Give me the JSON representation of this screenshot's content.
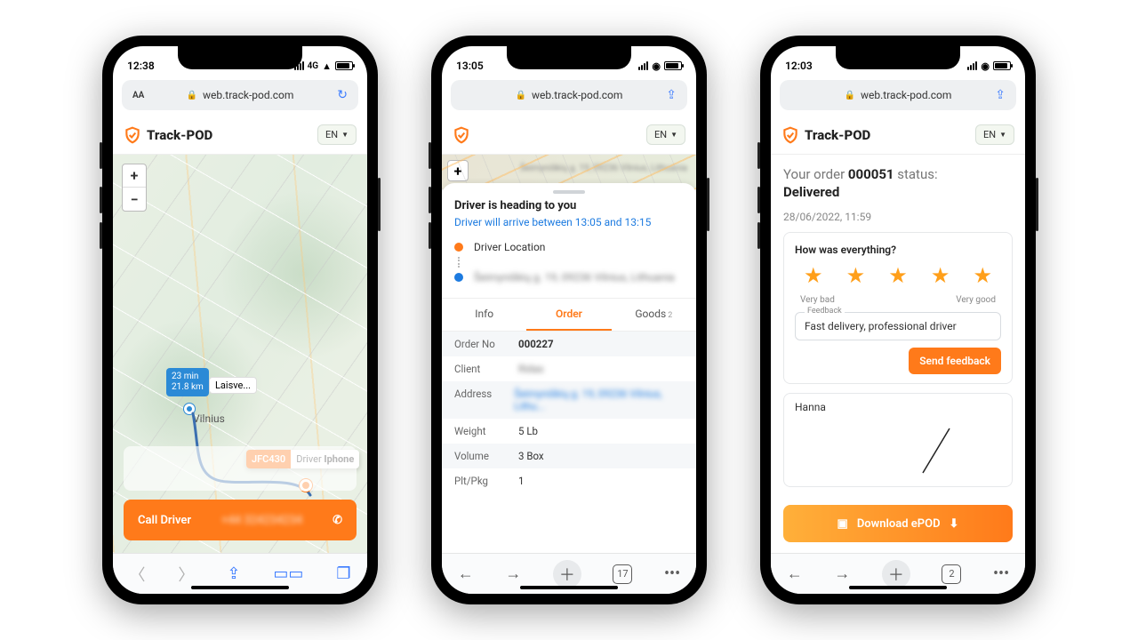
{
  "common": {
    "url": "web.track-pod.com",
    "brand": "Track-POD",
    "lang": "EN"
  },
  "phone1": {
    "time": "12:38",
    "net_label": "4G",
    "url_left": "AA",
    "zoom_in": "+",
    "zoom_out": "−",
    "route_time": "23 min",
    "route_dist": "21.8 km",
    "place": "Laisve...",
    "city": "Vilnius",
    "driver_tag": "JFC430",
    "driver_label_prefix": "Driver ",
    "driver_label_name": "Iphone",
    "call_label": "Call Driver",
    "call_number": "+44 324234234"
  },
  "phone2": {
    "time": "13:05",
    "heading": "Driver is heading to you",
    "eta": "Driver will arrive between 13:05 and 13:15",
    "driver_loc_label": "Driver Location",
    "dest_blur": "Šeimyniškių g. 19, 09236 Vilnius, Lithuania",
    "tabs": {
      "info": "Info",
      "order": "Order",
      "goods": "Goods",
      "goods_count": "2"
    },
    "order": {
      "k_orderno": "Order No",
      "v_orderno": "000227",
      "k_client": "Client",
      "v_client": "Ridas",
      "k_address": "Address",
      "v_address": "Šeimyniškių g. 19, 09236 Vilnius, Lithu...",
      "k_weight": "Weight",
      "v_weight": "5 Lb",
      "k_volume": "Volume",
      "v_volume": "3 Box",
      "k_plt": "Plt/Pkg",
      "v_plt": "1"
    },
    "tab_count": "17"
  },
  "phone3": {
    "time": "12:03",
    "status_pre": "Your order ",
    "order_no": "000051",
    "status_mid": " status:",
    "status_val": "Delivered",
    "timestamp": "28/06/2022, 11:59",
    "fb_title": "How was everything?",
    "scale_bad": "Very bad",
    "scale_good": "Very good",
    "fb_legend": "Feedback",
    "fb_text": "Fast delivery, professional driver",
    "send": "Send feedback",
    "signer": "Hanna",
    "download": "Download ePOD",
    "tab_count": "2"
  }
}
